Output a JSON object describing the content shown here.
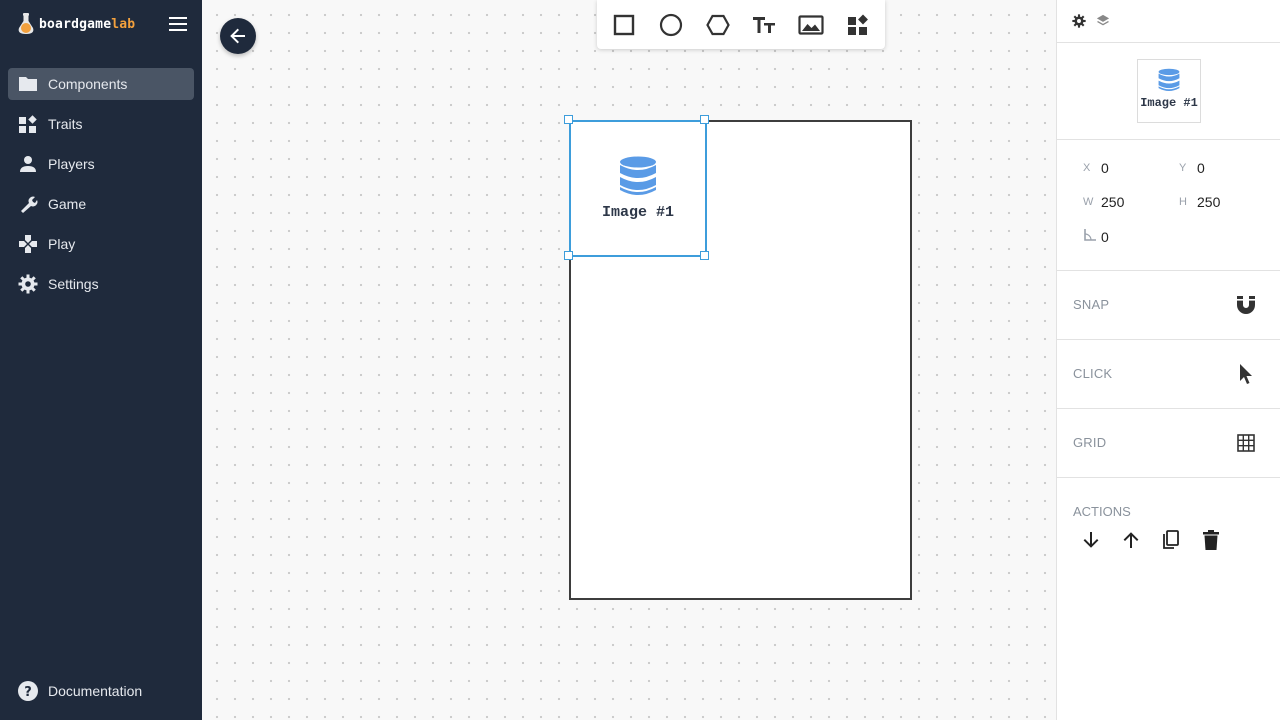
{
  "brand": {
    "name_main": "boardgame",
    "name_accent": "lab"
  },
  "nav": {
    "items": [
      {
        "label": "Components",
        "icon": "folder-icon",
        "active": true
      },
      {
        "label": "Traits",
        "icon": "widgets-icon"
      },
      {
        "label": "Players",
        "icon": "person-icon"
      },
      {
        "label": "Game",
        "icon": "wrench-icon"
      },
      {
        "label": "Play",
        "icon": "gamepad-icon"
      },
      {
        "label": "Settings",
        "icon": "gear-icon"
      }
    ],
    "documentation": "Documentation"
  },
  "toolbar": {
    "tools": [
      "rectangle-tool",
      "circle-tool",
      "hexagon-tool",
      "text-tool",
      "image-tool",
      "widgets-tool"
    ]
  },
  "canvas": {
    "element_label": "Image #1"
  },
  "panel": {
    "thumb_label": "Image #1",
    "props": {
      "x_label": "X",
      "x_value": "0",
      "y_label": "Y",
      "y_value": "0",
      "w_label": "W",
      "w_value": "250",
      "h_label": "H",
      "h_value": "250",
      "angle_value": "0"
    },
    "snap_label": "SNAP",
    "click_label": "CLICK",
    "grid_label": "GRID",
    "actions_label": "ACTIONS"
  },
  "colors": {
    "sidebar_bg": "#1f2a3c",
    "accent": "#f2a03d",
    "selection": "#3d9ddb",
    "image_icon": "#5a9be6"
  }
}
